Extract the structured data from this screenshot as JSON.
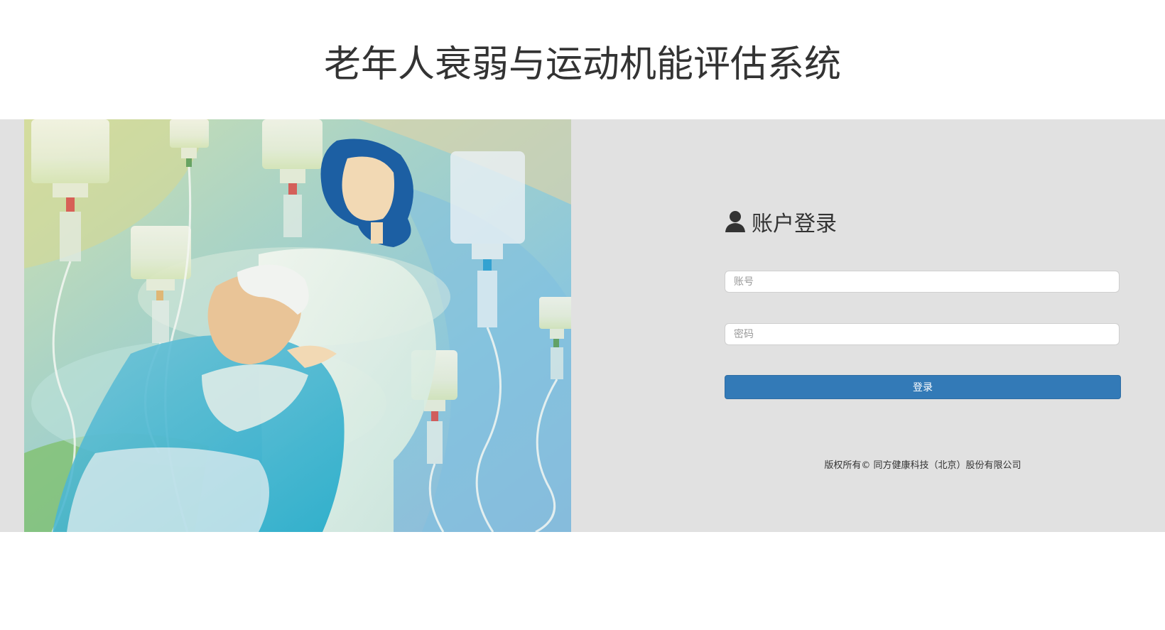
{
  "header": {
    "title": "老年人衰弱与运动机能评估系统"
  },
  "login": {
    "heading": "账户登录",
    "heading_icon": "user-icon",
    "account_placeholder": "账号",
    "account_value": "",
    "password_placeholder": "密码",
    "password_value": "",
    "submit_label": "登录",
    "button_color": "#337ab7"
  },
  "footer": {
    "copyright": "版权所有© 同方健康科技（北京）股份有限公司"
  },
  "colors": {
    "band_background": "#e1e1e1",
    "page_background": "#ffffff",
    "text": "#333333"
  },
  "illustration": {
    "subject": "caregiver-with-elderly-patient-iv-bottles"
  }
}
